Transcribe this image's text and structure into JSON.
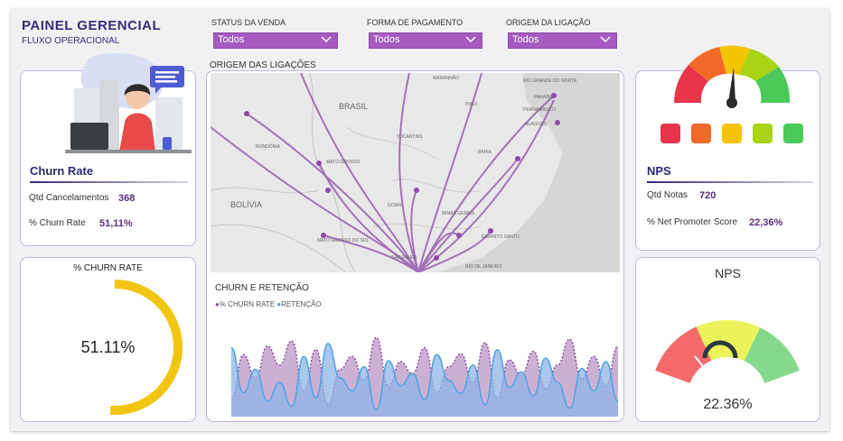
{
  "header": {
    "title": "PAINEL GERENCIAL",
    "subtitle": "FLUXO OPERACIONAL"
  },
  "filters": [
    {
      "label": "STATUS DA VENDA",
      "value": "Todos"
    },
    {
      "label": "FORMA DE PAGAMENTO",
      "value": "Todos"
    },
    {
      "label": "ORIGEM DA LIGAÇÃO",
      "value": "Todos"
    }
  ],
  "churn": {
    "title": "Churn Rate",
    "qtd_label": "Qtd Cancelamentos",
    "qtd_value": "368",
    "pct_label": "%  Churn Rate",
    "pct_value": "51,11%"
  },
  "churn_gauge": {
    "title": "% CHURN RATE",
    "value_text": "51.11%",
    "fraction": 0.5111,
    "color": "#f2c511"
  },
  "map": {
    "title": "ORIGEM DAS LIGAÇÕES",
    "labels": [
      "BRASIL",
      "BOLÍVIA",
      "MARANHÃO",
      "RIO GRANDE DO NORTE",
      "PARAÍBA",
      "PERNAMBUCO",
      "ALAGOAS",
      "PIAUÍ",
      "TOCANTINS",
      "BAHIA",
      "RONDÔNIA",
      "MATO GROSSO",
      "GOIÁS",
      "MINAS GERAIS",
      "ESPÍRITO SANTO",
      "MATO GROSSO DO SUL",
      "SÃO PAULO",
      "RIO DE JANEIRO"
    ]
  },
  "retention": {
    "title": "CHURN E RETENÇÃO",
    "legend": [
      {
        "name": "% CHURN RATE",
        "color": "#8a4d9e"
      },
      {
        "name": "RETENÇÃO",
        "color": "#4aa3e8"
      }
    ]
  },
  "chart_data": {
    "type": "area",
    "title": "CHURN E RETENÇÃO",
    "series": [
      {
        "name": "% CHURN RATE",
        "values": [
          0.2,
          0.72,
          0.45,
          0.82,
          0.6,
          0.88,
          0.3,
          0.78,
          0.15,
          0.55,
          0.7,
          0.42,
          0.92,
          0.35,
          0.64,
          0.5,
          0.8,
          0.28,
          0.58,
          0.73,
          0.4,
          0.86,
          0.22,
          0.66,
          0.48,
          0.76,
          0.32,
          0.6,
          0.9,
          0.44,
          0.7,
          0.36,
          0.82
        ]
      },
      {
        "name": "RETENÇÃO",
        "values": [
          0.8,
          0.28,
          0.55,
          0.18,
          0.4,
          0.12,
          0.7,
          0.22,
          0.85,
          0.45,
          0.3,
          0.58,
          0.08,
          0.65,
          0.36,
          0.5,
          0.2,
          0.72,
          0.42,
          0.27,
          0.6,
          0.14,
          0.78,
          0.34,
          0.52,
          0.24,
          0.68,
          0.4,
          0.1,
          0.56,
          0.3,
          0.64,
          0.18
        ]
      }
    ]
  },
  "nps": {
    "title": "NPS",
    "qtd_label": "Qtd Notas",
    "qtd_value": "720",
    "pct_label": "%  Net Promoter Score",
    "pct_value": "22,36%"
  },
  "nps_gauge": {
    "title": "NPS",
    "value_text": "22.36%",
    "fraction": 0.2236
  },
  "colors": {
    "accent": "#a55bbf",
    "navy": "#2b2a73",
    "gauge_red": "#f56a6a",
    "gauge_yellow": "#eaf45a",
    "gauge_green": "#86d98c"
  }
}
